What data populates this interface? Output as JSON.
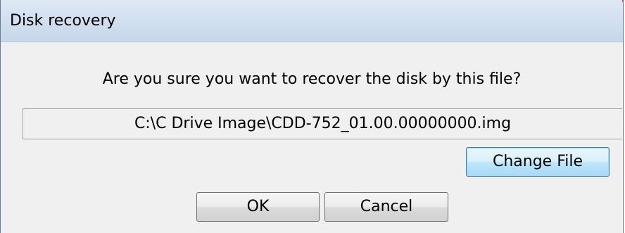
{
  "dialog": {
    "title": "Disk recovery",
    "message": "Are you sure you want to recover the disk by this file?",
    "file_path": "C:\\C Drive Image\\CDD-752_01.00.00000000.img",
    "buttons": {
      "change_file": "Change File",
      "ok": "OK",
      "cancel": "Cancel"
    }
  }
}
